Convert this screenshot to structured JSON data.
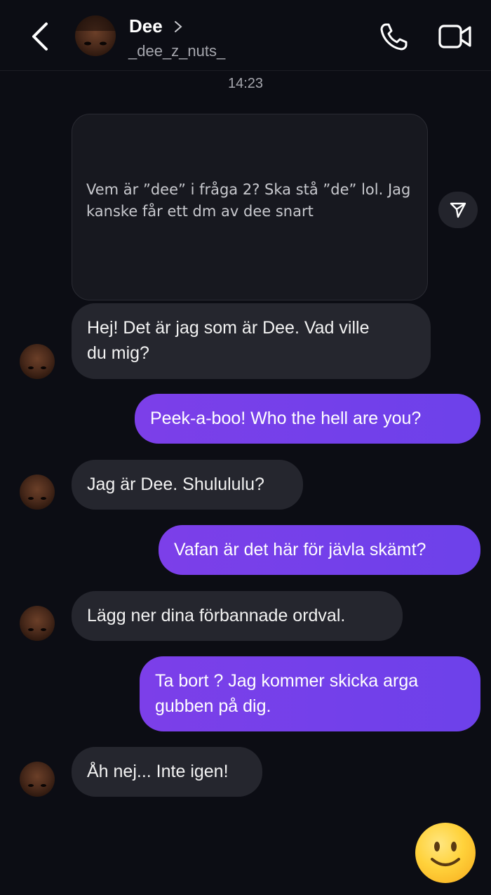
{
  "header": {
    "name": "Dee",
    "handle": "_dee_z_nuts_"
  },
  "timestamp": "14:23",
  "shared_post": {
    "text": "Vem är ”dee” i fråga 2? Ska stå ”de” lol. Jag kanske får ett dm av dee snart"
  },
  "messages": [
    {
      "from": "them",
      "text_lines": [
        "Hej! Det är jag som är Dee. Vad ville",
        "du mig?"
      ]
    },
    {
      "from": "me",
      "text": "Peek-a-boo! Who the hell are you?"
    },
    {
      "from": "them",
      "text": "Jag är Dee. Shulululu?"
    },
    {
      "from": "me",
      "text": "Vafan är det här för jävla skämt?"
    },
    {
      "from": "them",
      "text": "Lägg ner dina förbannade ordval."
    },
    {
      "from": "me",
      "text_lines": [
        "Ta bort ? Jag kommer skicka arga",
        "gubben på dig."
      ]
    },
    {
      "from": "them",
      "text": "Åh nej... Inte igen!"
    }
  ],
  "colors": {
    "background": "#0c0d14",
    "incoming_bubble": "#25262e",
    "outgoing_bubble": "#7c3fe9"
  },
  "icons": [
    "back-icon",
    "chevron-right-icon",
    "phone-icon",
    "video-camera-icon",
    "share-icon",
    "smiley-emoji-icon"
  ]
}
